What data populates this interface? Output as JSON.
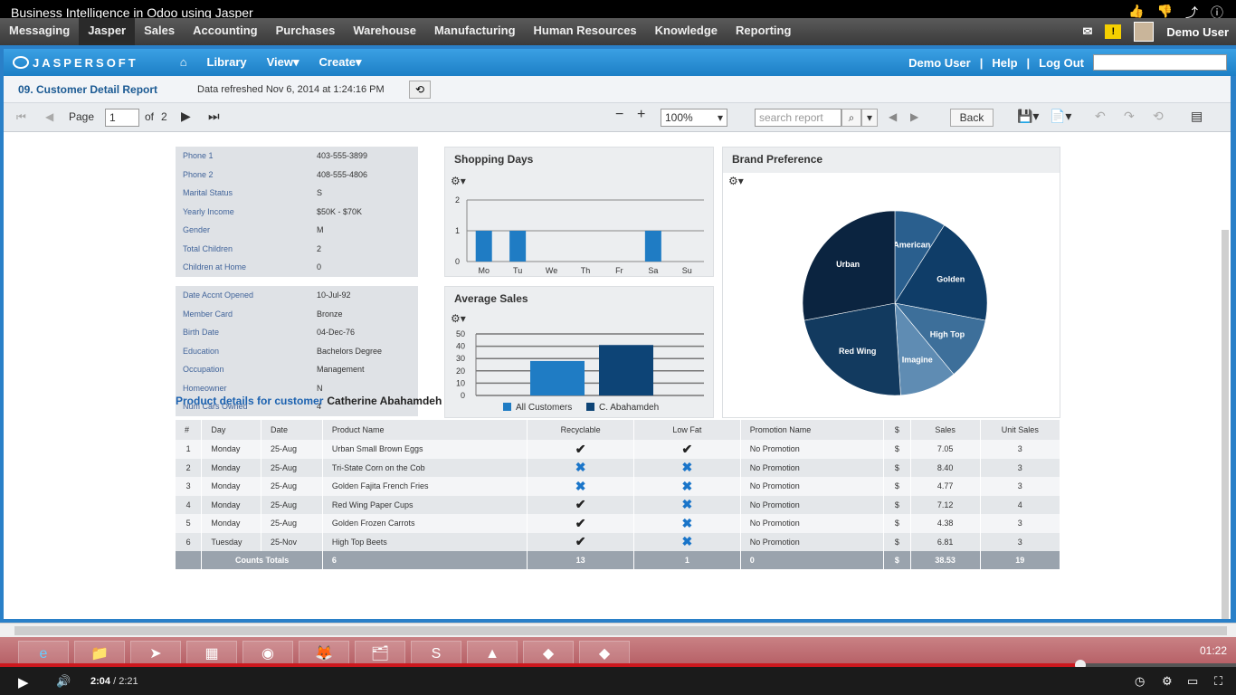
{
  "video": {
    "title": "Business Intelligence in Odoo using Jasper",
    "time_current": "2:04",
    "time_separator": "/",
    "time_total": "2:21"
  },
  "odoo_menu": {
    "items": [
      "Messaging",
      "Jasper",
      "Sales",
      "Accounting",
      "Purchases",
      "Warehouse",
      "Manufacturing",
      "Human Resources",
      "Knowledge",
      "Reporting"
    ],
    "active": "Jasper",
    "user": "Demo User"
  },
  "jasper_header": {
    "logo": "JASPERSOFT",
    "nav": [
      "Library",
      "View",
      "Create"
    ],
    "user": "Demo User",
    "help": "Help",
    "logout": "Log Out"
  },
  "report": {
    "title": "09. Customer Detail Report",
    "refreshed": "Data refreshed Nov 6, 2014 at 1:24:16 PM"
  },
  "toolbar": {
    "page_label": "Page",
    "page_value": "1",
    "of_label": "of",
    "total_pages": "2",
    "zoom": "100%",
    "search_placeholder": "search report",
    "back": "Back"
  },
  "customer_info_1": [
    {
      "k": "Phone 1",
      "v": "403-555-3899"
    },
    {
      "k": "Phone 2",
      "v": "408-555-4806"
    },
    {
      "k": "Marital Status",
      "v": "S"
    },
    {
      "k": "Yearly Income",
      "v": "$50K - $70K"
    },
    {
      "k": "Gender",
      "v": "M"
    },
    {
      "k": "Total Children",
      "v": "2"
    },
    {
      "k": "Children at Home",
      "v": "0"
    }
  ],
  "customer_info_2": [
    {
      "k": "Date Accnt Opened",
      "v": "10-Jul-92"
    },
    {
      "k": "Member Card",
      "v": "Bronze"
    },
    {
      "k": "Birth Date",
      "v": "04-Dec-76"
    },
    {
      "k": "Education",
      "v": "Bachelors Degree"
    },
    {
      "k": "Occupation",
      "v": "Management"
    },
    {
      "k": "Homeowner",
      "v": "N"
    },
    {
      "k": "Num Cars Owned",
      "v": "4"
    }
  ],
  "chart_data": [
    {
      "type": "bar",
      "title": "Shopping Days",
      "categories": [
        "Mo",
        "Tu",
        "We",
        "Th",
        "Fr",
        "Sa",
        "Su"
      ],
      "values": [
        1,
        1,
        0,
        0,
        0,
        1,
        0
      ],
      "ylim": [
        0,
        2
      ],
      "yticks": [
        0,
        1,
        2
      ],
      "grid": true,
      "color": "#1f7cc4"
    },
    {
      "type": "bar",
      "title": "Average Sales",
      "categories": [
        "All Customers",
        "C. Abahamdeh"
      ],
      "values": [
        28,
        41
      ],
      "ylim": [
        0,
        50
      ],
      "yticks": [
        0,
        10,
        20,
        30,
        40,
        50
      ],
      "grid": true,
      "colors": [
        "#1f7cc4",
        "#0d4476"
      ],
      "legend": [
        {
          "name": "All Customers",
          "color": "#1f7cc4"
        },
        {
          "name": "C. Abahamdeh",
          "color": "#0d4476"
        }
      ],
      "legend_position": "bottom"
    },
    {
      "type": "pie",
      "title": "Brand Preference",
      "slices": [
        {
          "label": "American",
          "value": 9,
          "color": "#2a5f8e"
        },
        {
          "label": "Golden",
          "value": 19,
          "color": "#0f3d68"
        },
        {
          "label": "High Top",
          "value": 11,
          "color": "#3d6f9a"
        },
        {
          "label": "Imagine",
          "value": 10,
          "color": "#5f8cb3"
        },
        {
          "label": "Red Wing",
          "value": 23,
          "color": "#123a5f"
        },
        {
          "label": "Urban",
          "value": 28,
          "color": "#0b2440"
        }
      ]
    }
  ],
  "products": {
    "heading": "Product details for customer",
    "customer": "Catherine Abahamdeh",
    "columns": [
      "#",
      "Day",
      "Date",
      "Product Name",
      "Recyclable",
      "Low Fat",
      "Promotion Name",
      "$",
      "Sales",
      "Unit Sales"
    ],
    "rows": [
      {
        "n": "1",
        "day": "Monday",
        "date": "25-Aug",
        "product": "Urban Small Brown Eggs",
        "recyclable": true,
        "lowfat": true,
        "promo": "No Promotion",
        "cur": "$",
        "sales": "7.05",
        "units": "3"
      },
      {
        "n": "2",
        "day": "Monday",
        "date": "25-Aug",
        "product": "Tri-State Corn on the Cob",
        "recyclable": false,
        "lowfat": false,
        "promo": "No Promotion",
        "cur": "$",
        "sales": "8.40",
        "units": "3"
      },
      {
        "n": "3",
        "day": "Monday",
        "date": "25-Aug",
        "product": "Golden Fajita French Fries",
        "recyclable": false,
        "lowfat": false,
        "promo": "No Promotion",
        "cur": "$",
        "sales": "4.77",
        "units": "3"
      },
      {
        "n": "4",
        "day": "Monday",
        "date": "25-Aug",
        "product": "Red Wing Paper Cups",
        "recyclable": true,
        "lowfat": false,
        "promo": "No Promotion",
        "cur": "$",
        "sales": "7.12",
        "units": "4"
      },
      {
        "n": "5",
        "day": "Monday",
        "date": "25-Aug",
        "product": "Golden Frozen Carrots",
        "recyclable": true,
        "lowfat": false,
        "promo": "No Promotion",
        "cur": "$",
        "sales": "4.38",
        "units": "3"
      },
      {
        "n": "6",
        "day": "Tuesday",
        "date": "25-Nov",
        "product": "High Top Beets",
        "recyclable": true,
        "lowfat": false,
        "promo": "No Promotion",
        "cur": "$",
        "sales": "6.81",
        "units": "3"
      }
    ],
    "totals": {
      "label": "Counts Totals",
      "n": "6",
      "recyclable": "13",
      "lowfat": "1",
      "promo": "0",
      "cur": "$",
      "sales": "38.53",
      "units": "19"
    }
  },
  "taskbar": {
    "clock": "01:22"
  }
}
